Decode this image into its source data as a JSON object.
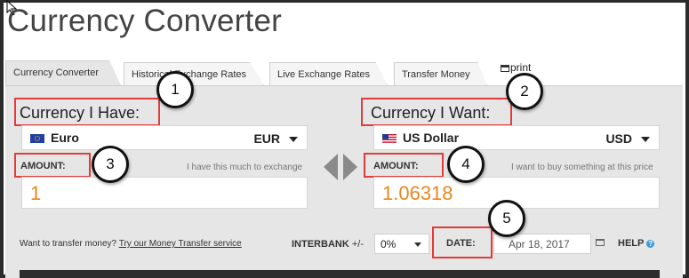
{
  "page_title": "Currency Converter",
  "tabs": [
    {
      "label": "Currency Converter",
      "active": true
    },
    {
      "label": "Historical Exchange Rates",
      "active": false
    },
    {
      "label": "Live Exchange Rates",
      "active": false
    },
    {
      "label": "Transfer Money",
      "active": false
    }
  ],
  "print_label": "print",
  "have": {
    "heading": "Currency I Have:",
    "currency_name": "Euro",
    "currency_code": "EUR",
    "amount_label": "AMOUNT:",
    "amount_hint": "I have this much to exchange",
    "amount_value": "1"
  },
  "want": {
    "heading": "Currency I Want:",
    "currency_name": "US Dollar",
    "currency_code": "USD",
    "amount_label": "AMOUNT:",
    "amount_hint": "I want to buy something at this price",
    "amount_value": "1.06318"
  },
  "footer": {
    "transfer_question": "Want to transfer money?",
    "transfer_link": "Try our Money Transfer service",
    "interbank_label": "INTERBANK",
    "interbank_pm": "+/-",
    "interbank_value": "0%",
    "date_label": "DATE:",
    "date_value": "Apr 18, 2017",
    "help_label": "HELP",
    "help_icon_glyph": "?"
  },
  "callouts": [
    "1",
    "2",
    "3",
    "4",
    "5"
  ],
  "colors": {
    "annotation_red": "#e23b3b",
    "amount_orange": "#e8871e",
    "panel_bg": "#e6e6e6",
    "help_blue": "#3b9bd6"
  },
  "icons": [
    "cursor-arrow-icon",
    "print-icon",
    "eu-flag-icon",
    "us-flag-icon",
    "dropdown-caret-icon",
    "swap-arrows-icon",
    "calendar-icon",
    "help-icon"
  ]
}
